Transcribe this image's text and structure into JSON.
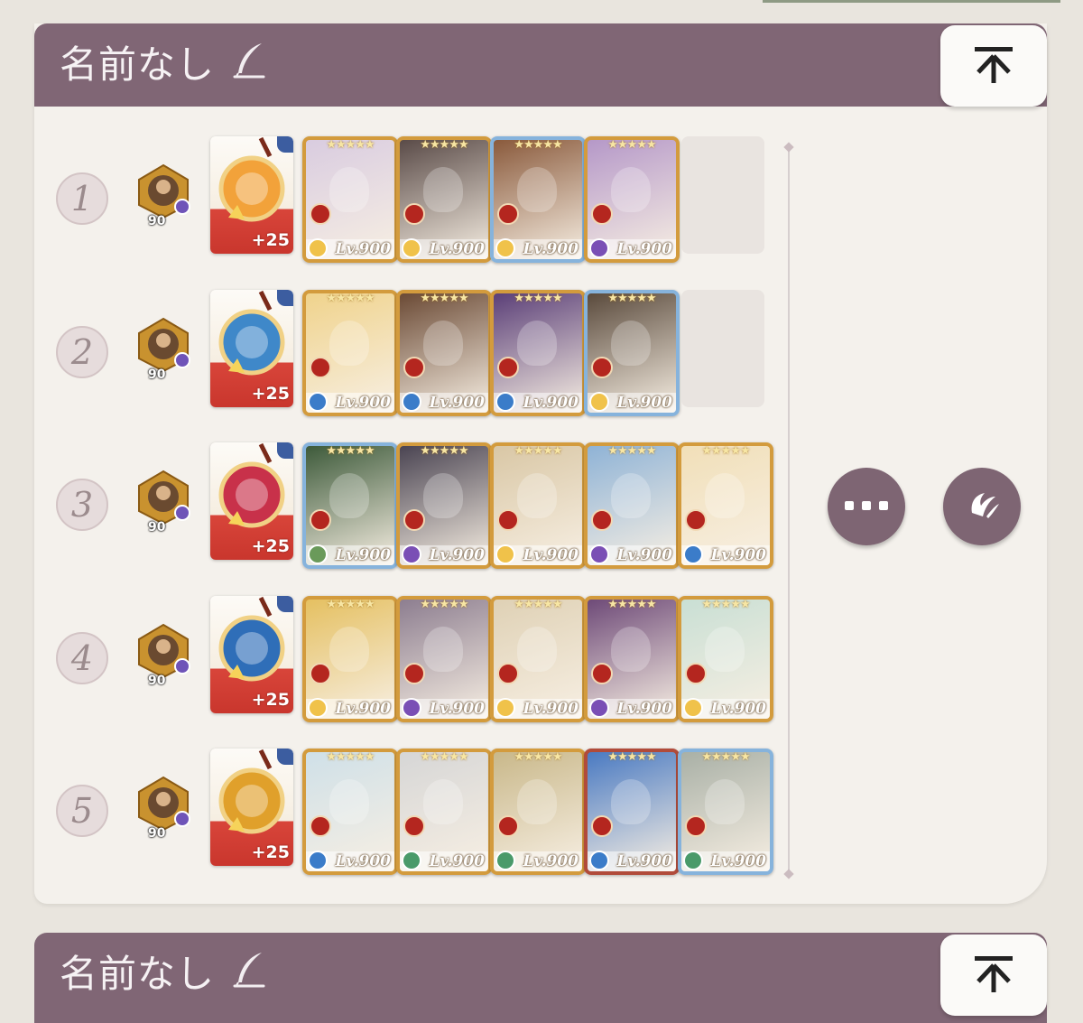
{
  "deck": {
    "title": "名前なし",
    "rows": [
      {
        "number": "1",
        "leader_level": "90",
        "equip_bonus": "+25",
        "equip_color": "#f2a23a",
        "units": [
          {
            "level": "Lv.900",
            "frame": "gold",
            "art": "#d9cce0",
            "attr_color": "#f0c24a"
          },
          {
            "level": "Lv.900",
            "frame": "gold",
            "art": "#5a4b48",
            "attr_color": "#f0c24a"
          },
          {
            "level": "Lv.900",
            "frame": "blue",
            "art": "#8a5a3c",
            "attr_color": "#f0c24a"
          },
          {
            "level": "Lv.900",
            "frame": "gold",
            "art": "#b598c8",
            "attr_color": "#7a4fb5"
          }
        ],
        "empty_slot": true
      },
      {
        "number": "2",
        "leader_level": "90",
        "equip_bonus": "+25",
        "equip_color": "#3f88c9",
        "units": [
          {
            "level": "Lv.900",
            "frame": "gold",
            "art": "#f0d38c",
            "attr_color": "#3b7cc9"
          },
          {
            "level": "Lv.900",
            "frame": "gold",
            "art": "#6b4a35",
            "attr_color": "#3b7cc9"
          },
          {
            "level": "Lv.900",
            "frame": "gold",
            "art": "#5b3f78",
            "attr_color": "#3b7cc9"
          },
          {
            "level": "Lv.900",
            "frame": "blue",
            "art": "#5a4a3c",
            "attr_color": "#f0c24a"
          }
        ],
        "empty_slot": true
      },
      {
        "number": "3",
        "leader_level": "90",
        "equip_bonus": "+25",
        "equip_color": "#c8314a",
        "units": [
          {
            "level": "Lv.900",
            "frame": "blue",
            "art": "#3d5a3a",
            "attr_color": "#6a9a5a"
          },
          {
            "level": "Lv.900",
            "frame": "gold",
            "art": "#4a4452",
            "attr_color": "#7a4fb5"
          },
          {
            "level": "Lv.900",
            "frame": "gold",
            "art": "#d9c7a5",
            "attr_color": "#f0c24a"
          },
          {
            "level": "Lv.900",
            "frame": "gold",
            "art": "#8fb3d6",
            "attr_color": "#7a4fb5"
          },
          {
            "level": "Lv.900",
            "frame": "gold",
            "art": "#f1dfb8",
            "attr_color": "#3b7cc9"
          }
        ],
        "empty_slot": false
      },
      {
        "number": "4",
        "leader_level": "90",
        "equip_bonus": "+25",
        "equip_color": "#2f6eb8",
        "units": [
          {
            "level": "Lv.900",
            "frame": "gold",
            "art": "#e5c061",
            "attr_color": "#f0c24a"
          },
          {
            "level": "Lv.900",
            "frame": "gold",
            "art": "#8d7e90",
            "attr_color": "#7a4fb5"
          },
          {
            "level": "Lv.900",
            "frame": "gold",
            "art": "#dfd1b5",
            "attr_color": "#f0c24a"
          },
          {
            "level": "Lv.900",
            "frame": "gold",
            "art": "#6e4a78",
            "attr_color": "#7a4fb5"
          },
          {
            "level": "Lv.900",
            "frame": "gold",
            "art": "#c9dfd4",
            "attr_color": "#f0c24a"
          }
        ],
        "empty_slot": false
      },
      {
        "number": "5",
        "leader_level": "90",
        "equip_bonus": "+25",
        "equip_color": "#e0a02b",
        "units": [
          {
            "level": "Lv.900",
            "frame": "gold",
            "art": "#cfe0e8",
            "attr_color": "#3b7cc9"
          },
          {
            "level": "Lv.900",
            "frame": "gold",
            "art": "#d6d6d6",
            "attr_color": "#4a9a6a"
          },
          {
            "level": "Lv.900",
            "frame": "gold",
            "art": "#c9b88a",
            "attr_color": "#4a9a6a"
          },
          {
            "level": "Lv.900",
            "frame": "red",
            "art": "#4a7ac2",
            "attr_color": "#3b7cc9"
          },
          {
            "level": "Lv.900",
            "frame": "blue",
            "art": "#a9b0a6",
            "attr_color": "#4a9a6a"
          }
        ],
        "empty_slot": false
      }
    ]
  },
  "next_deck": {
    "title": "名前なし"
  },
  "icons": {
    "quill": "quill-icon",
    "top": "arrow-to-top-icon",
    "more": "more-dots-icon",
    "rename": "emblem-quill-icon"
  }
}
